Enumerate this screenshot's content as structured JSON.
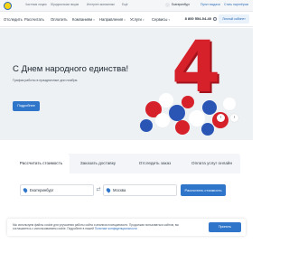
{
  "topbar": {
    "links": [
      "Частным лицам",
      "Юридическим лицам",
      "Интернет-магазинам",
      "Ещё"
    ],
    "city": "Екатеринбург",
    "right_links": [
      "Пункт выдачи",
      "Стать партнёром"
    ]
  },
  "nav": {
    "items": [
      "Отследить",
      "Рассчитать",
      "Оплатить",
      "Компаниям",
      "Направления",
      "Услуги",
      "Сервисы"
    ],
    "phone": "8 800 554-04-40",
    "account_label": "Личный кабинет"
  },
  "hero": {
    "title": "С Днем народного единства!",
    "subtitle": "График работы в праздничные дни ноября.",
    "button_label": "Подробнее",
    "digit": "4",
    "accent_color": "#2f76cb",
    "digit_color": "#d6202a"
  },
  "tabs": [
    {
      "label": "Рассчитать стоимость",
      "active": true
    },
    {
      "label": "Заказать доставку",
      "active": false
    },
    {
      "label": "Отследить заказ",
      "active": false
    },
    {
      "label": "Оплата услуг онлайн",
      "active": false
    }
  ],
  "calculator": {
    "from_value": "Екатеринбург",
    "to_value": "Москва",
    "submit_label": "Рассчитать стоимость"
  },
  "cookie": {
    "text": "Мы используем файлы cookie для улучшения работы сайта и анализа посещаемости. Продолжая пользоваться сайтом, вы соглашаетесь с использованием cookie. Подробнее в нашей",
    "link": "Политике конфиденциальности",
    "button_label": "Принять"
  }
}
